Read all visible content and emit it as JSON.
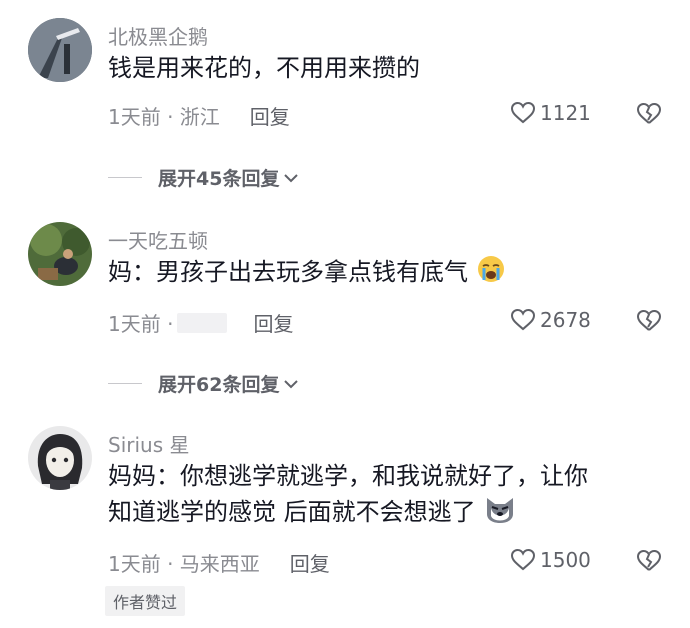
{
  "comments": [
    {
      "username": "北极黑企鹅",
      "text": "钱是用来花的，不用用来攒的",
      "time_location": "1天前 · 浙江",
      "reply_label": "回复",
      "likes": "1121",
      "expand_label": "展开45条回复"
    },
    {
      "username": "一天吃五顿",
      "text": "妈：男孩子出去玩多拿点钱有底气",
      "time_location": "1天前 ·",
      "reply_label": "回复",
      "likes": "2678",
      "expand_label": "展开62条回复",
      "emoji": "crying-face-icon"
    },
    {
      "username": "Sirius 星",
      "text_line1": "妈妈：你想逃学就逃学，和我说就好了，让你",
      "text_line2": "知道逃学的感觉 后面就不会想逃了",
      "time_location": "1天前 · 马来西亚",
      "reply_label": "回复",
      "likes": "1500",
      "author_badge": "作者赞过",
      "emoji": "dog-face-icon"
    }
  ],
  "colors": {
    "text_primary": "#161823",
    "text_secondary": "#8a8b91",
    "action_gray": "#5f6168"
  }
}
